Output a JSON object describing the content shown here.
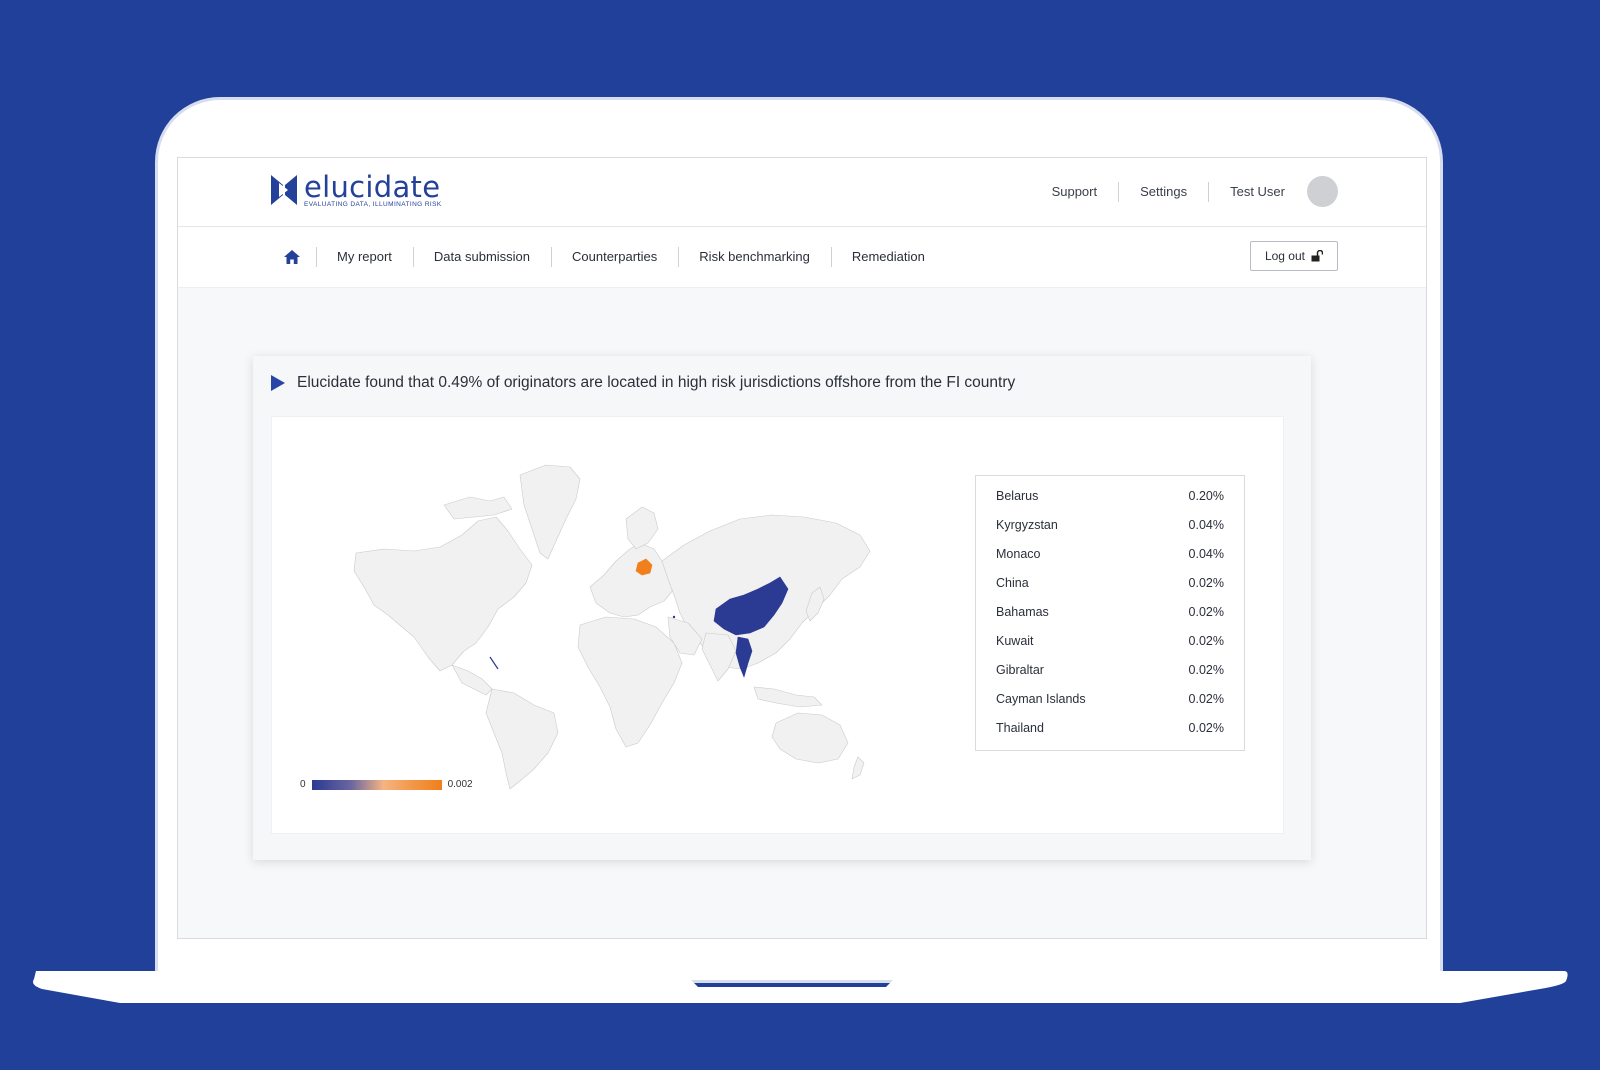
{
  "brand": {
    "name": "elucidate",
    "tagline": "EVALUATING DATA, ILLUMINATING RISK",
    "color": "#24419a"
  },
  "user_nav": {
    "support": "Support",
    "settings": "Settings",
    "user": "Test User"
  },
  "main_nav": {
    "home_icon": "home-icon",
    "items": [
      "My report",
      "Data submission",
      "Counterparties",
      "Risk benchmarking",
      "Remediation"
    ],
    "logout_label": "Log out",
    "logout_icon": "unlock-icon"
  },
  "card": {
    "title": "Elucidate found that 0.49% of originators are located in high risk jurisdictions offshore from the FI country"
  },
  "chart_data": {
    "type": "choropleth",
    "colorbar": {
      "min_label": "0",
      "max_label": "0.002",
      "min_color": "#2b3a93",
      "max_color": "#f07f1c"
    },
    "highlighted": [
      {
        "country": "Belarus",
        "color": "#f07f1c"
      },
      {
        "country": "China",
        "color": "#2b3a93"
      },
      {
        "country": "Thailand",
        "color": "#2b3a93"
      }
    ],
    "table": [
      {
        "country": "Belarus",
        "value": "0.20%"
      },
      {
        "country": "Kyrgyzstan",
        "value": "0.04%"
      },
      {
        "country": "Monaco",
        "value": "0.04%"
      },
      {
        "country": "China",
        "value": "0.02%"
      },
      {
        "country": "Bahamas",
        "value": "0.02%"
      },
      {
        "country": "Kuwait",
        "value": "0.02%"
      },
      {
        "country": "Gibraltar",
        "value": "0.02%"
      },
      {
        "country": "Cayman Islands",
        "value": "0.02%"
      },
      {
        "country": "Thailand",
        "value": "0.02%"
      }
    ]
  }
}
